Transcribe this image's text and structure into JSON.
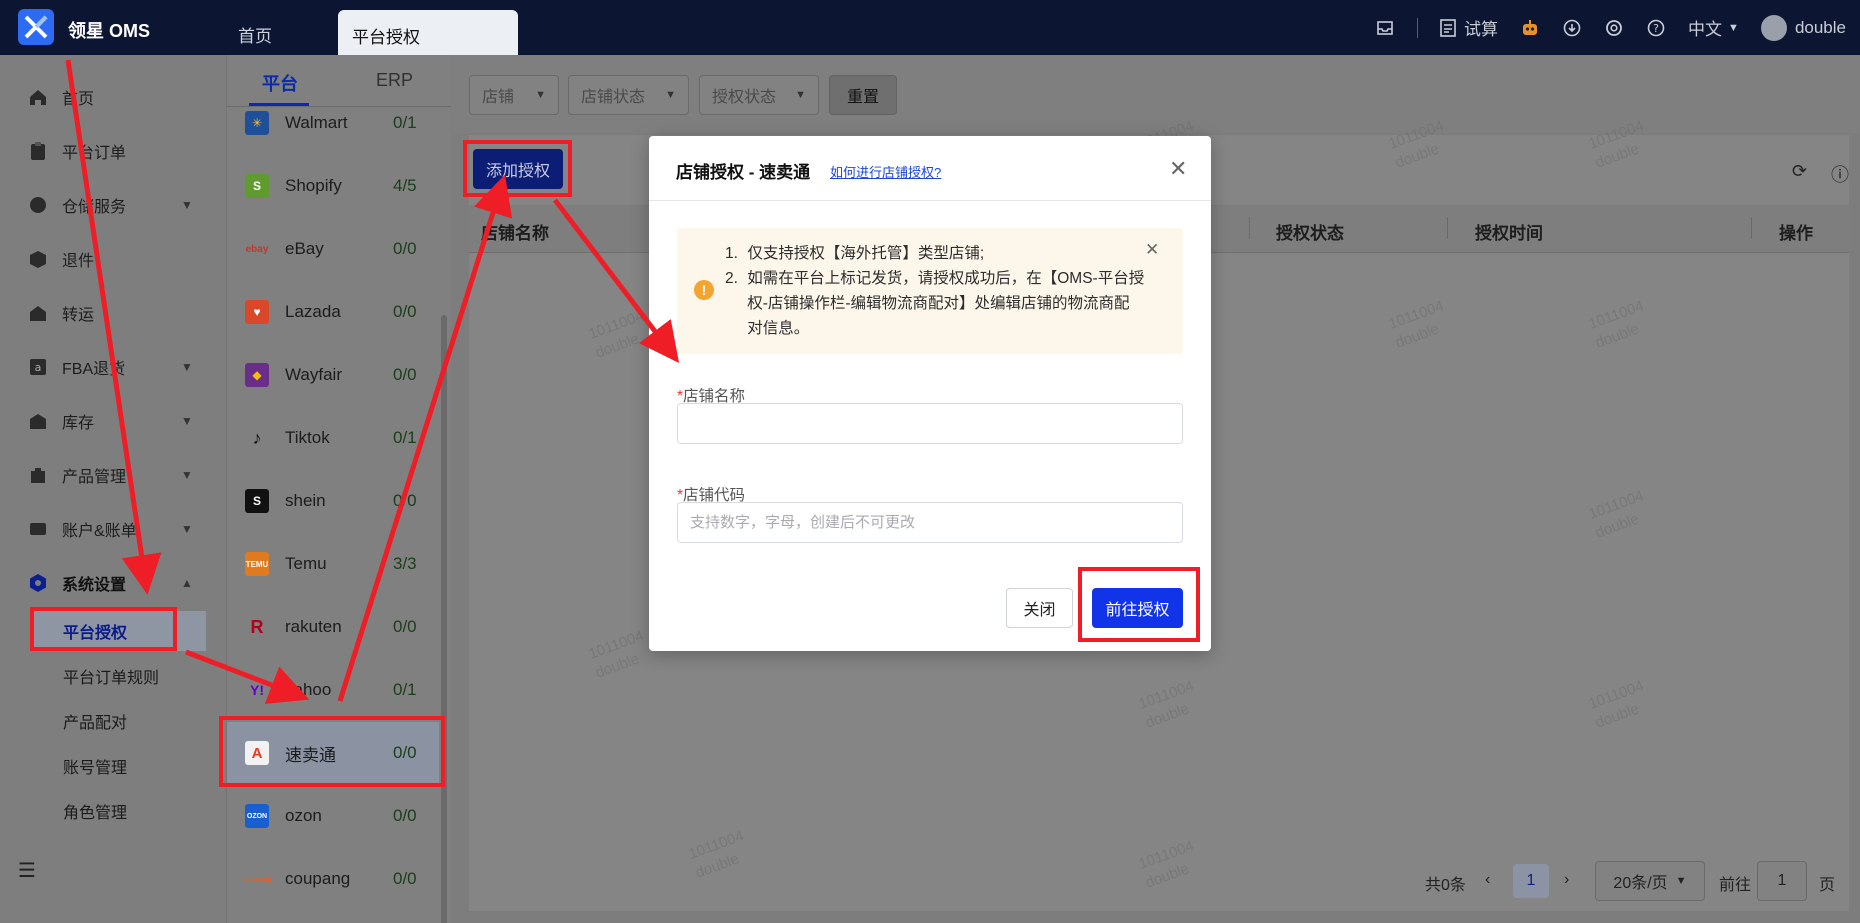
{
  "app": {
    "name": "领星 OMS"
  },
  "top_tabs": [
    {
      "label": "首页"
    },
    {
      "label": "平台授权"
    }
  ],
  "top_right": {
    "trial_label": "试算",
    "language": "中文",
    "username": "double"
  },
  "sidebar": {
    "items": [
      {
        "label": "首页",
        "icon": "home-icon",
        "expandable": false
      },
      {
        "label": "平台订单",
        "icon": "clipboard-icon",
        "expandable": false
      },
      {
        "label": "仓储服务",
        "icon": "warehouse-icon",
        "expandable": true
      },
      {
        "label": "退件",
        "icon": "return-box-icon",
        "expandable": false
      },
      {
        "label": "转运",
        "icon": "transfer-icon",
        "expandable": false
      },
      {
        "label": "FBA退货",
        "icon": "amazon-icon",
        "expandable": true
      },
      {
        "label": "库存",
        "icon": "inventory-icon",
        "expandable": true
      },
      {
        "label": "产品管理",
        "icon": "product-icon",
        "expandable": true
      },
      {
        "label": "账户&账单",
        "icon": "bill-icon",
        "expandable": true
      },
      {
        "label": "系统设置",
        "icon": "settings-hex-icon",
        "expandable": true
      }
    ],
    "sub_items": [
      {
        "label": "平台授权",
        "active": true
      },
      {
        "label": "平台订单规则",
        "active": false
      },
      {
        "label": "产品配对",
        "active": false
      },
      {
        "label": "账号管理",
        "active": false
      },
      {
        "label": "角色管理",
        "active": false
      }
    ]
  },
  "platform_panel": {
    "tabs": [
      {
        "label": "平台"
      },
      {
        "label": "ERP"
      }
    ],
    "platforms": [
      {
        "name": "Walmart",
        "count": "0/1",
        "color": "#2a6fd6"
      },
      {
        "name": "Shopify",
        "count": "4/5",
        "color": "#5f9b2f"
      },
      {
        "name": "eBay",
        "count": "0/0",
        "color": "#c0392b"
      },
      {
        "name": "Lazada",
        "count": "0/0",
        "color": "#d9482b"
      },
      {
        "name": "Wayfair",
        "count": "0/0",
        "color": "#6b2d8a"
      },
      {
        "name": "Tiktok",
        "count": "0/1",
        "color": "#111111"
      },
      {
        "name": "shein",
        "count": "0/0",
        "color": "#111111"
      },
      {
        "name": "Temu",
        "count": "3/3",
        "color": "#e07a1f"
      },
      {
        "name": "rakuten",
        "count": "0/0",
        "color": "#b3001b"
      },
      {
        "name": "yahoo",
        "count": "0/1",
        "color": "#5f01d1"
      },
      {
        "name": "速卖通",
        "count": "0/0",
        "color": "#e43b1e"
      },
      {
        "name": "ozon",
        "count": "0/0",
        "color": "#1a5fd0"
      },
      {
        "name": "coupang",
        "count": "0/0",
        "color": "#d9632b"
      }
    ]
  },
  "filters": {
    "store_placeholder": "店铺",
    "store_status_placeholder": "店铺状态",
    "auth_status_placeholder": "授权状态",
    "reset_label": "重置"
  },
  "table": {
    "add_button": "添加授权",
    "columns": {
      "store_name": "店铺名称",
      "auth_status": "授权状态",
      "auth_time": "授权时间",
      "actions": "操作"
    }
  },
  "pagination": {
    "total": "共0条",
    "current_page": "1",
    "page_size": "20条/页",
    "goto_label": "前往",
    "goto_value": "1",
    "page_suffix": "页"
  },
  "watermark": {
    "id": "1011004",
    "user": "double"
  },
  "modal": {
    "title": "店铺授权 - 速卖通",
    "help_link": "如何进行店铺授权?",
    "notice": [
      "仅支持授权【海外托管】类型店铺;",
      "如需在平台上标记发货，请授权成功后，在【OMS-平台授权-店铺操作栏-编辑物流商配对】处编辑店铺的物流商配对信息。"
    ],
    "store_name_label": "店铺名称",
    "store_name_value": "",
    "store_code_label": "店铺代码",
    "store_code_placeholder": "支持数字，字母，创建后不可更改",
    "close_button": "关闭",
    "authorize_button": "前往授权"
  },
  "colors": {
    "primary": "#1234e8",
    "annotation": "#ef1d25",
    "topbar": "#0c1633",
    "warning_bg": "#fdf6ea"
  }
}
